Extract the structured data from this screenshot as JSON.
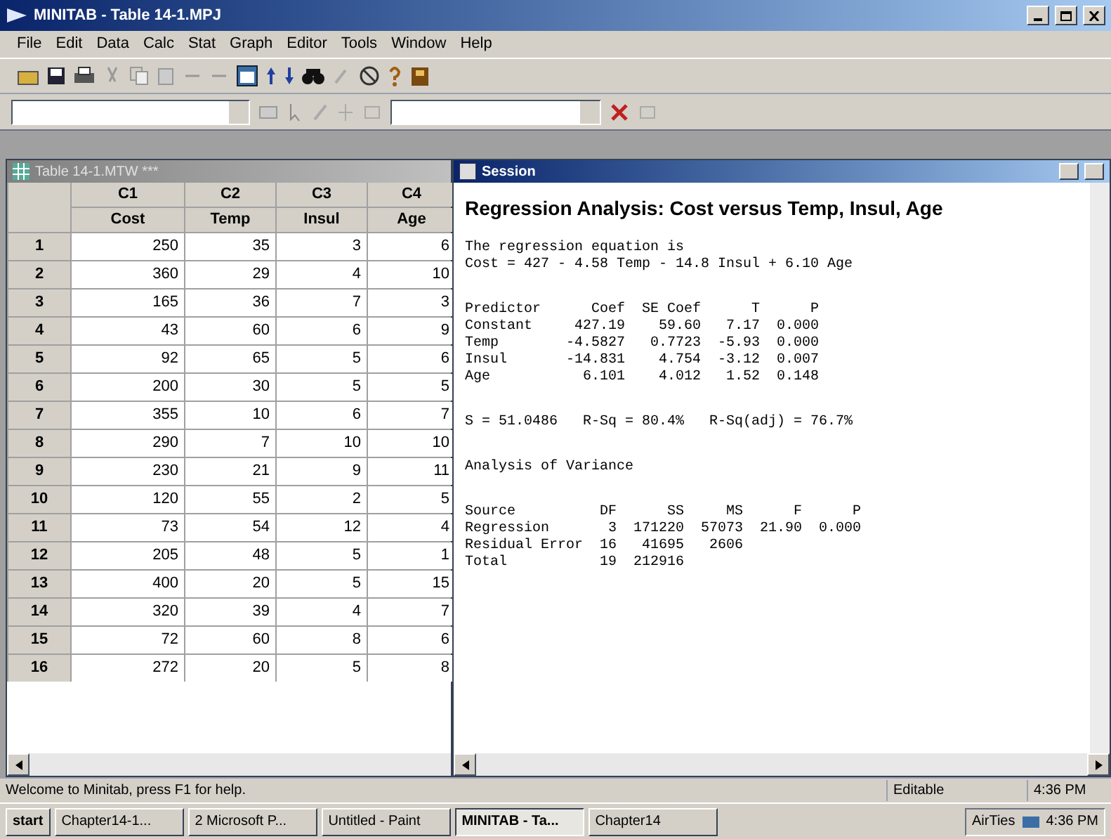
{
  "window": {
    "title": "MINITAB - Table 14-1.MPJ"
  },
  "menu": [
    "File",
    "Edit",
    "Data",
    "Calc",
    "Stat",
    "Graph",
    "Editor",
    "Tools",
    "Window",
    "Help"
  ],
  "worksheet": {
    "title": "Table 14-1.MTW ***",
    "columns": [
      {
        "id": "C1",
        "name": "Cost"
      },
      {
        "id": "C2",
        "name": "Temp"
      },
      {
        "id": "C3",
        "name": "Insul"
      },
      {
        "id": "C4",
        "name": "Age"
      }
    ],
    "rows": [
      {
        "number": "1",
        "cells": [
          "250",
          "35",
          "3",
          "6"
        ]
      },
      {
        "number": "2",
        "cells": [
          "360",
          "29",
          "4",
          "10"
        ]
      },
      {
        "number": "3",
        "cells": [
          "165",
          "36",
          "7",
          "3"
        ]
      },
      {
        "number": "4",
        "cells": [
          "43",
          "60",
          "6",
          "9"
        ]
      },
      {
        "number": "5",
        "cells": [
          "92",
          "65",
          "5",
          "6"
        ]
      },
      {
        "number": "6",
        "cells": [
          "200",
          "30",
          "5",
          "5"
        ]
      },
      {
        "number": "7",
        "cells": [
          "355",
          "10",
          "6",
          "7"
        ]
      },
      {
        "number": "8",
        "cells": [
          "290",
          "7",
          "10",
          "10"
        ]
      },
      {
        "number": "9",
        "cells": [
          "230",
          "21",
          "9",
          "11"
        ]
      },
      {
        "number": "10",
        "cells": [
          "120",
          "55",
          "2",
          "5"
        ]
      },
      {
        "number": "11",
        "cells": [
          "73",
          "54",
          "12",
          "4"
        ]
      },
      {
        "number": "12",
        "cells": [
          "205",
          "48",
          "5",
          "1"
        ]
      },
      {
        "number": "13",
        "cells": [
          "400",
          "20",
          "5",
          "15"
        ]
      },
      {
        "number": "14",
        "cells": [
          "320",
          "39",
          "4",
          "7"
        ]
      },
      {
        "number": "15",
        "cells": [
          "72",
          "60",
          "8",
          "6"
        ]
      },
      {
        "number": "16",
        "cells": [
          "272",
          "20",
          "5",
          "8"
        ]
      }
    ]
  },
  "session": {
    "title": "Session",
    "heading": "Regression Analysis: Cost versus Temp, Insul, Age",
    "blocks": [
      [
        "The regression equation is",
        "Cost = 427 - 4.58 Temp - 14.8 Insul + 6.10 Age"
      ],
      [
        "Predictor      Coef  SE Coef      T      P",
        "Constant     427.19    59.60   7.17  0.000",
        "Temp        -4.5827   0.7723  -5.93  0.000",
        "Insul       -14.831    4.754  -3.12  0.007",
        "Age           6.101    4.012   1.52  0.148"
      ],
      [
        "S = 51.0486   R-Sq = 80.4%   R-Sq(adj) = 76.7%"
      ],
      [
        "Analysis of Variance"
      ],
      [
        "Source          DF      SS     MS      F      P",
        "Regression       3  171220  57073  21.90  0.000",
        "Residual Error  16   41695   2606",
        "Total           19  212916"
      ]
    ]
  },
  "status_bar": {
    "message": "Welcome to Minitab, press F1 for help.",
    "mode": "Editable",
    "time": "4:36 PM"
  },
  "taskbar": {
    "start": "start",
    "buttons": [
      {
        "label": "Chapter14-1...",
        "selected": false
      },
      {
        "label": "2 Microsoft P...",
        "selected": false
      },
      {
        "label": "Untitled - Paint",
        "selected": false
      },
      {
        "label": "MINITAB - Ta...",
        "selected": true
      },
      {
        "label": "Chapter14",
        "selected": false
      }
    ],
    "tray": "AirTies",
    "clock": "4:36 PM"
  }
}
